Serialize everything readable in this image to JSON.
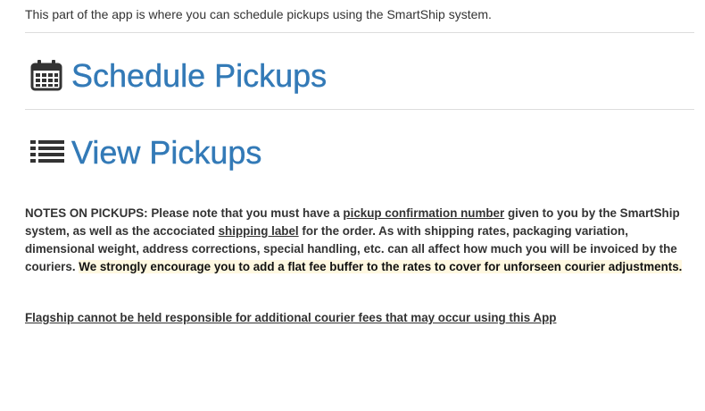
{
  "intro": {
    "text": "This part of the app is where you can schedule pickups using the SmartShip system."
  },
  "sections": {
    "schedule": {
      "title": "Schedule Pickups",
      "icon": "calendar-icon"
    },
    "view": {
      "title": "View Pickups",
      "icon": "list-icon"
    }
  },
  "notes": {
    "part1": "NOTES ON PICKUPS: Please note that you must have a ",
    "link1": "pickup confirmation number",
    "part2": " given to you by the SmartShip system, as well as the accociated ",
    "link2": "shipping label",
    "part3": " for the order. As with shipping rates, packaging variation, dimensional weight, address corrections, special handling, etc. can all affect how much you will be invoiced by the couriers. ",
    "highlight": "We strongly encourage you to add a flat fee buffer to the rates to cover for unforseen courier adjustments."
  },
  "disclaimer": {
    "text": "Flagship cannot be held responsible for additional courier fees that may occur using this App"
  },
  "colors": {
    "link": "#337ab7",
    "highlight_bg": "#fff8e1",
    "rule": "#dddddd"
  }
}
